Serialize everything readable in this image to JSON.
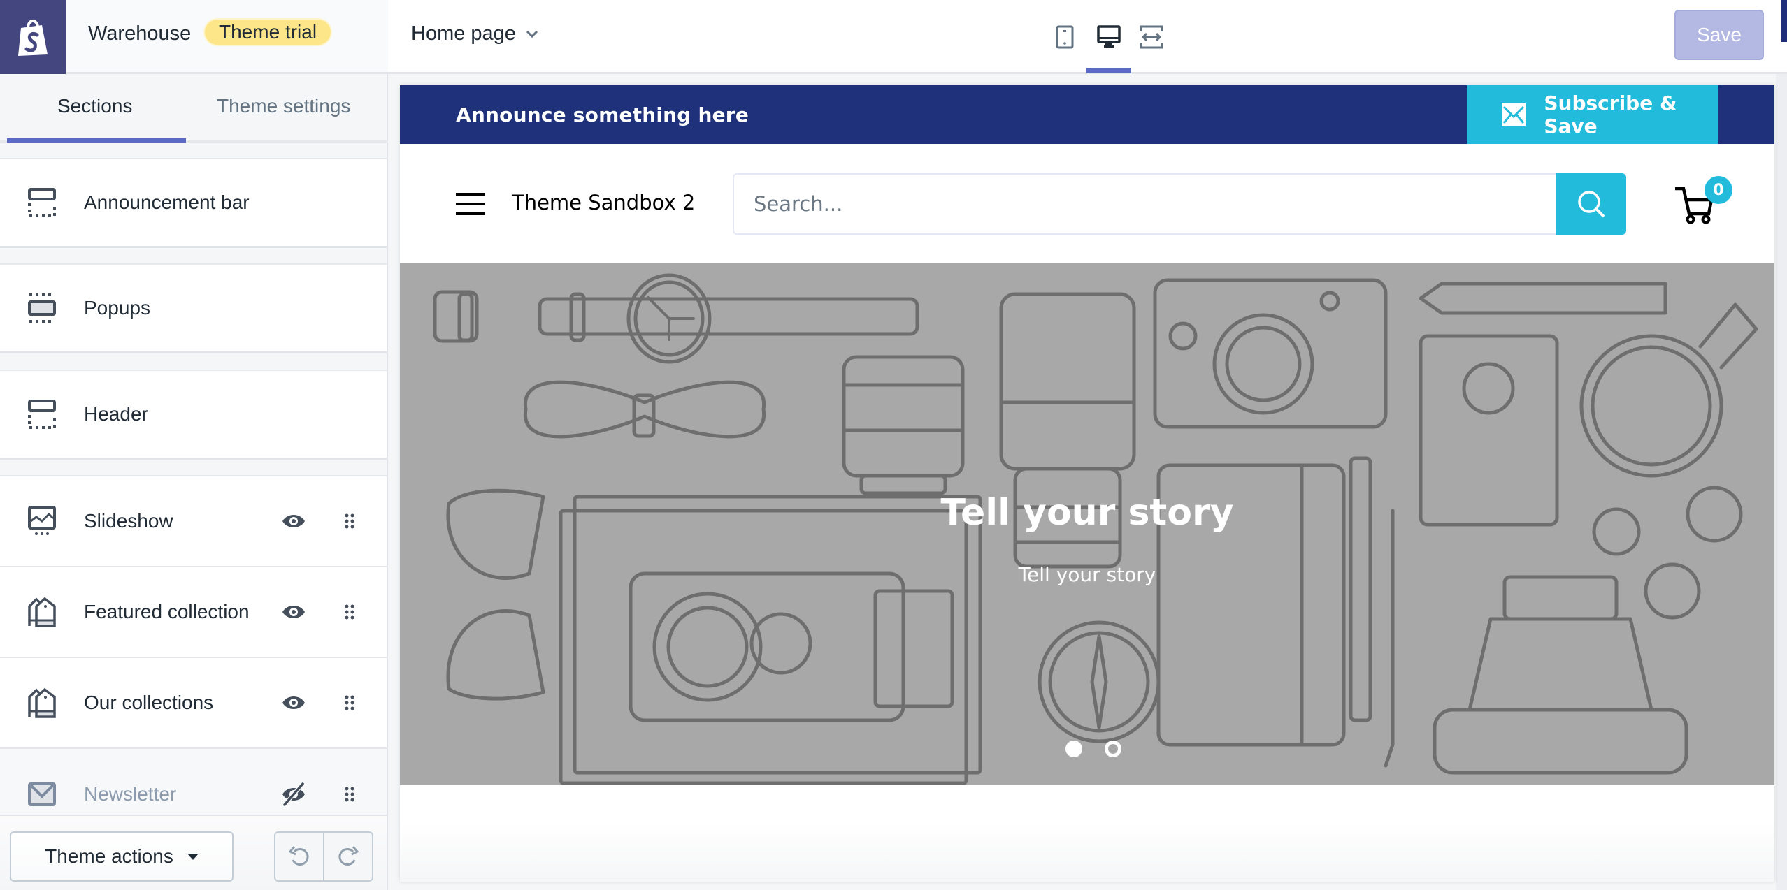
{
  "app": {
    "store_name": "Warehouse",
    "badge": "Theme trial",
    "brand_color": "#43467f",
    "accent_color": "#5c6ac4"
  },
  "sidebar": {
    "tabs": [
      {
        "label": "Sections",
        "active": true
      },
      {
        "label": "Theme settings",
        "active": false
      }
    ],
    "fixed_sections": [
      {
        "label": "Announcement bar",
        "icon": "announcement-bar-icon"
      },
      {
        "label": "Popups",
        "icon": "popup-icon"
      },
      {
        "label": "Header",
        "icon": "header-icon"
      }
    ],
    "sections": [
      {
        "label": "Slideshow",
        "icon": "slideshow-icon",
        "visible": true
      },
      {
        "label": "Featured collection",
        "icon": "collection-icon",
        "visible": true
      },
      {
        "label": "Our collections",
        "icon": "collection-icon",
        "visible": true
      },
      {
        "label": "Newsletter",
        "icon": "mail-icon",
        "visible": false
      }
    ],
    "footer": {
      "theme_actions_label": "Theme actions",
      "undo_icon": "undo-icon",
      "redo_icon": "redo-icon"
    }
  },
  "toolbar": {
    "page_select": "Home page",
    "devices": [
      {
        "name": "mobile",
        "active": false
      },
      {
        "name": "desktop",
        "active": true
      },
      {
        "name": "full-width",
        "active": false
      }
    ],
    "save_label": "Save",
    "save_disabled": true
  },
  "preview": {
    "announcement": {
      "text": "Announce something here",
      "button_label": "Subscribe & Save",
      "bg_color": "#1f317a",
      "button_color": "#22bbdc"
    },
    "header": {
      "shop_name": "Theme Sandbox 2",
      "search_placeholder": "Search...",
      "search_value": "",
      "cart_count": "0"
    },
    "slideshow": {
      "title": "Tell your story",
      "subtitle": "Tell your story",
      "slide_count": 2,
      "active_slide": 1
    }
  }
}
